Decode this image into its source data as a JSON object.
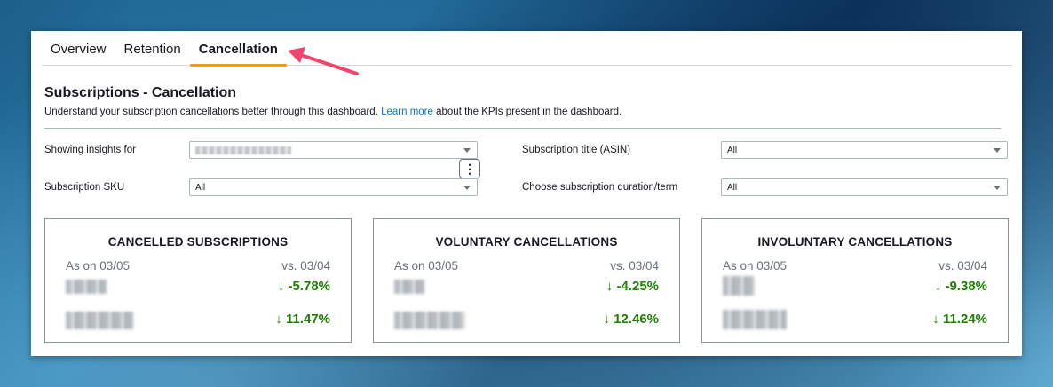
{
  "tabs": [
    {
      "label": "Overview",
      "active": false
    },
    {
      "label": "Retention",
      "active": false
    },
    {
      "label": "Cancellation",
      "active": true
    }
  ],
  "page": {
    "title": "Subscriptions - Cancellation",
    "subtitle_before": "Understand your subscription cancellations better through this dashboard.",
    "learn_more": "Learn more",
    "subtitle_after": "about the KPIs present in the dashboard."
  },
  "filters": {
    "insights_label": "Showing insights for",
    "sku_label": "Subscription SKU",
    "sku_value": "All",
    "asin_label": "Subscription title (ASIN)",
    "asin_value": "All",
    "term_label": "Choose subscription duration/term",
    "term_value": "All"
  },
  "cards": [
    {
      "title": "CANCELLED SUBSCRIPTIONS",
      "as_of": "As on 03/05",
      "vs": "vs. 03/04",
      "change1": "-5.78%",
      "change2": "11.47%"
    },
    {
      "title": "VOLUNTARY CANCELLATIONS",
      "as_of": "As on 03/05",
      "vs": "vs. 03/04",
      "change1": "-4.25%",
      "change2": "12.46%"
    },
    {
      "title": "INVOLUNTARY CANCELLATIONS",
      "as_of": "As on 03/05",
      "vs": "vs. 03/04",
      "change1": "-9.38%",
      "change2": "11.24%"
    }
  ],
  "icons": {
    "trend": "down-arrow-icon",
    "more": "kebab-menu-icon"
  },
  "colors": {
    "accent_tab": "#ec9a2a",
    "positive": "#1d8102",
    "link": "#0972d3",
    "annotation_arrow": "#f0466e"
  }
}
